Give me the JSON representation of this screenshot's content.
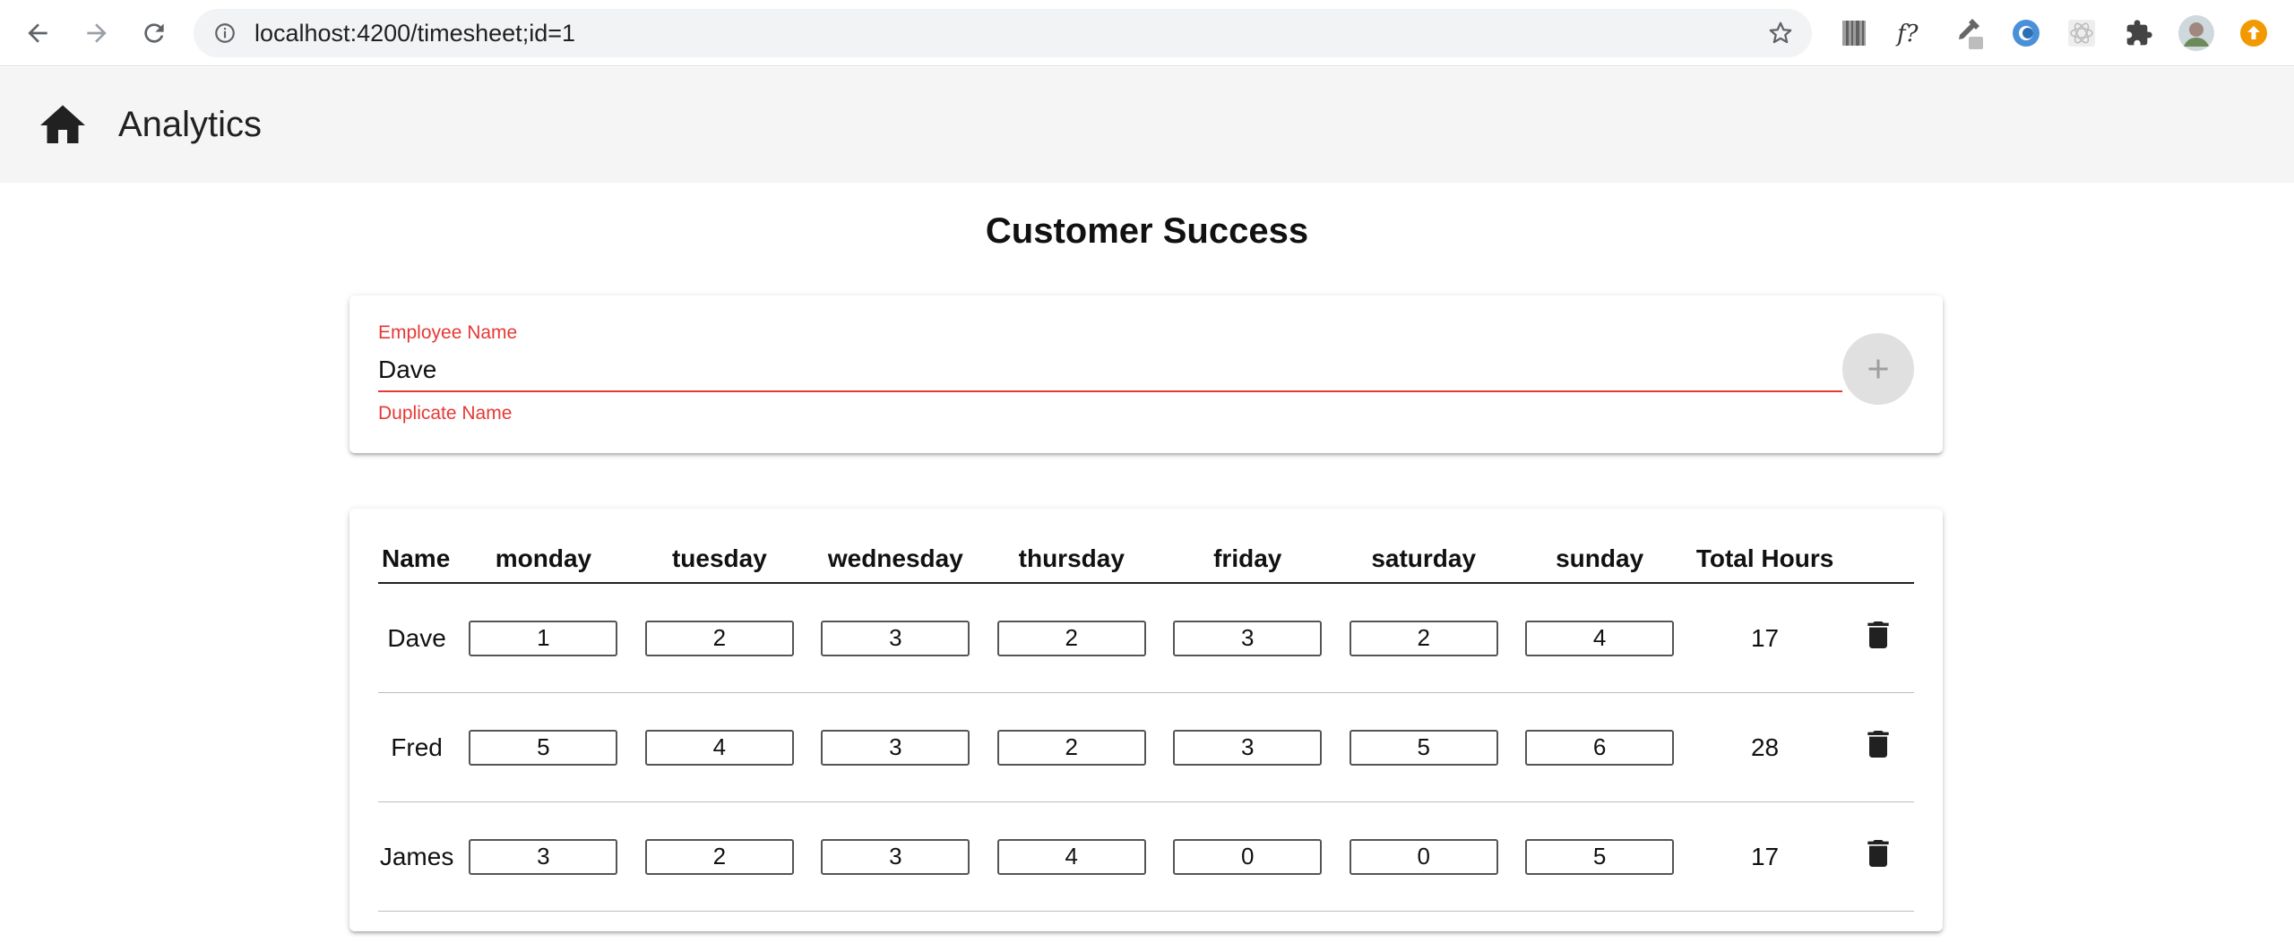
{
  "browser": {
    "url": "localhost:4200/timesheet;id=1",
    "extensions": [
      "barcode-extension-icon",
      "fonts-ninja-extension-icon",
      "color-picker-extension-icon",
      "blue-circle-extension-icon",
      "react-devtools-extension-icon",
      "extensions-puzzle-icon",
      "profile-avatar",
      "update-arrow-icon"
    ]
  },
  "app": {
    "title": "Analytics"
  },
  "page": {
    "title": "Customer Success"
  },
  "form": {
    "label": "Employee Name",
    "value": "Dave",
    "error": "Duplicate Name",
    "error_color": "#e53935"
  },
  "table": {
    "headers": {
      "name": "Name",
      "monday": "monday",
      "tuesday": "tuesday",
      "wednesday": "wednesday",
      "thursday": "thursday",
      "friday": "friday",
      "saturday": "saturday",
      "sunday": "sunday",
      "total": "Total Hours"
    },
    "rows": [
      {
        "name": "Dave",
        "hours": [
          "1",
          "2",
          "3",
          "2",
          "3",
          "2",
          "4"
        ],
        "total": "17"
      },
      {
        "name": "Fred",
        "hours": [
          "5",
          "4",
          "3",
          "2",
          "3",
          "5",
          "6"
        ],
        "total": "28"
      },
      {
        "name": "James",
        "hours": [
          "3",
          "2",
          "3",
          "4",
          "0",
          "0",
          "5"
        ],
        "total": "17"
      }
    ]
  }
}
